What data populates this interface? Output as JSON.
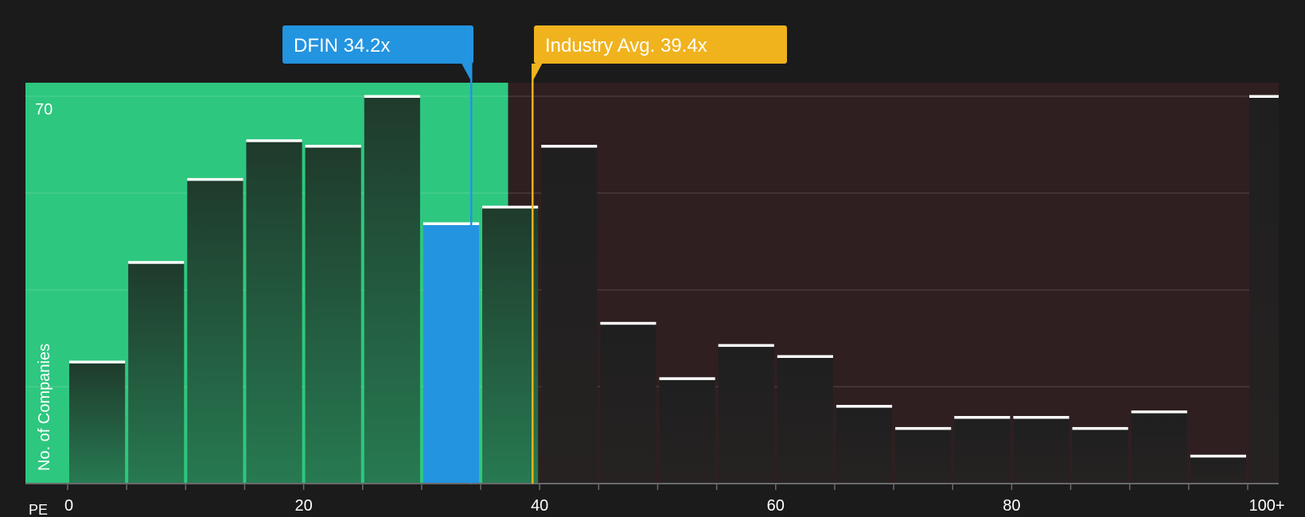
{
  "chart_data": {
    "type": "bar",
    "xlabel": "PE",
    "ylabel": "No. of Companies",
    "ytick_label": "70",
    "ylim": [
      0,
      70
    ],
    "xlim": [
      0,
      102
    ],
    "x_ticks": [
      0,
      20,
      40,
      60,
      80,
      100
    ],
    "x_tick_labels": [
      "0",
      "20",
      "40",
      "60",
      "80",
      "100+"
    ],
    "grid": true,
    "bins": [
      {
        "start": 0,
        "end": 5,
        "value": 22
      },
      {
        "start": 5,
        "end": 10,
        "value": 40
      },
      {
        "start": 10,
        "end": 15,
        "value": 55
      },
      {
        "start": 15,
        "end": 20,
        "value": 62
      },
      {
        "start": 20,
        "end": 25,
        "value": 61
      },
      {
        "start": 25,
        "end": 30,
        "value": 70
      },
      {
        "start": 30,
        "end": 35,
        "value": 47,
        "highlight": true
      },
      {
        "start": 35,
        "end": 40,
        "value": 50
      },
      {
        "start": 40,
        "end": 45,
        "value": 61
      },
      {
        "start": 45,
        "end": 50,
        "value": 29
      },
      {
        "start": 50,
        "end": 55,
        "value": 19
      },
      {
        "start": 55,
        "end": 60,
        "value": 25
      },
      {
        "start": 60,
        "end": 65,
        "value": 23
      },
      {
        "start": 65,
        "end": 70,
        "value": 14
      },
      {
        "start": 70,
        "end": 75,
        "value": 10
      },
      {
        "start": 75,
        "end": 80,
        "value": 12
      },
      {
        "start": 80,
        "end": 85,
        "value": 12
      },
      {
        "start": 85,
        "end": 90,
        "value": 10
      },
      {
        "start": 90,
        "end": 95,
        "value": 13
      },
      {
        "start": 95,
        "end": 100,
        "value": 5
      },
      {
        "start": 100,
        "end": 102,
        "value": 70
      }
    ],
    "markers": {
      "company": {
        "label": "DFIN 34.2x",
        "value": 34.2,
        "color": "#2394e0"
      },
      "industry": {
        "label": "Industry Avg. 39.4x",
        "value": 39.4,
        "color": "#f0b31e"
      }
    },
    "undervalued_region_end": 38,
    "colors": {
      "background": "#1b1b1b",
      "good_zone": "#2ec77f",
      "bad_zone": "#2f1f20",
      "bar_dark": "#1e1e1e",
      "bar_highlight": "#2394e0",
      "cap": "#ffffff",
      "axis": "#6a6a6a",
      "tick_text": "#ffffff"
    }
  }
}
